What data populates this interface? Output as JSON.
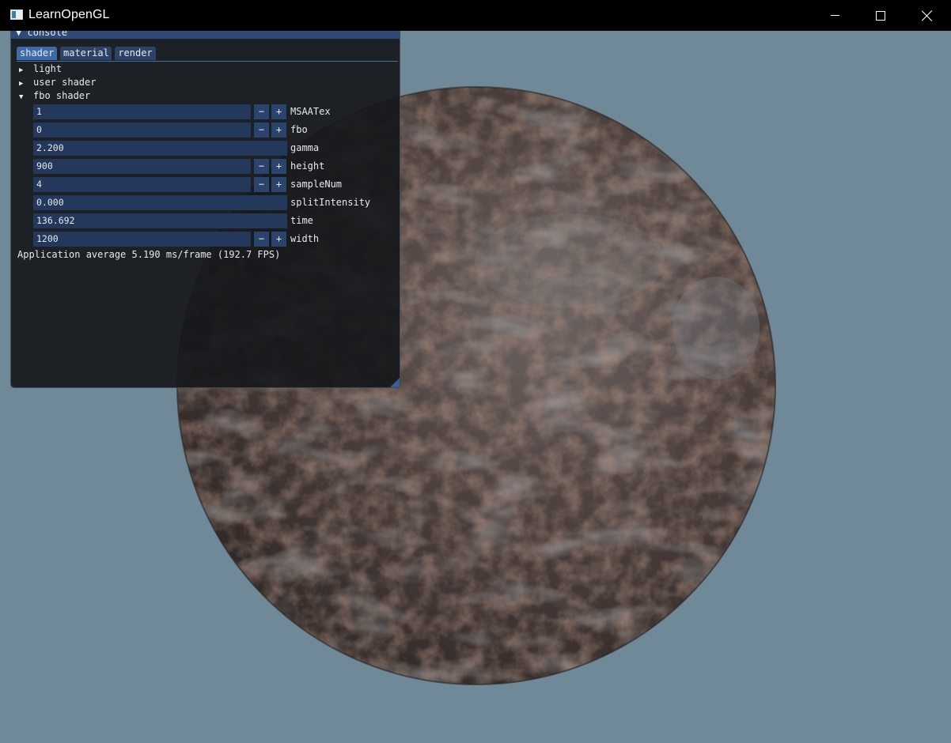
{
  "window": {
    "title": "LearnOpenGL",
    "icon": "app-window-icon",
    "controls": [
      "minimize-icon",
      "maximize-icon",
      "close-icon"
    ]
  },
  "scene": {
    "background_color": "#6f8998",
    "object": "textured rusty sphere"
  },
  "console": {
    "title": "console",
    "tabs": [
      {
        "label": "shader",
        "active": true
      },
      {
        "label": "material",
        "active": false
      },
      {
        "label": "render",
        "active": false
      }
    ],
    "tree": [
      {
        "label": "light",
        "expanded": false
      },
      {
        "label": "user shader",
        "expanded": false
      },
      {
        "label": "fbo shader",
        "expanded": true
      }
    ],
    "properties": [
      {
        "label": "MSAATex",
        "value": "1",
        "stepper": true
      },
      {
        "label": "fbo",
        "value": "0",
        "stepper": true
      },
      {
        "label": "gamma",
        "value": "2.200",
        "stepper": false
      },
      {
        "label": "height",
        "value": "900",
        "stepper": true
      },
      {
        "label": "sampleNum",
        "value": "4",
        "stepper": true
      },
      {
        "label": "splitIntensity",
        "value": "0.000",
        "stepper": false
      },
      {
        "label": "time",
        "value": "136.692",
        "stepper": false
      },
      {
        "label": "width",
        "value": "1200",
        "stepper": true
      }
    ],
    "stepper_minus": "−",
    "stepper_plus": "+",
    "fps_text": "Application average 5.190 ms/frame (192.7 FPS)",
    "collapse_arrow": "▼",
    "expand_arrow": "▶"
  }
}
